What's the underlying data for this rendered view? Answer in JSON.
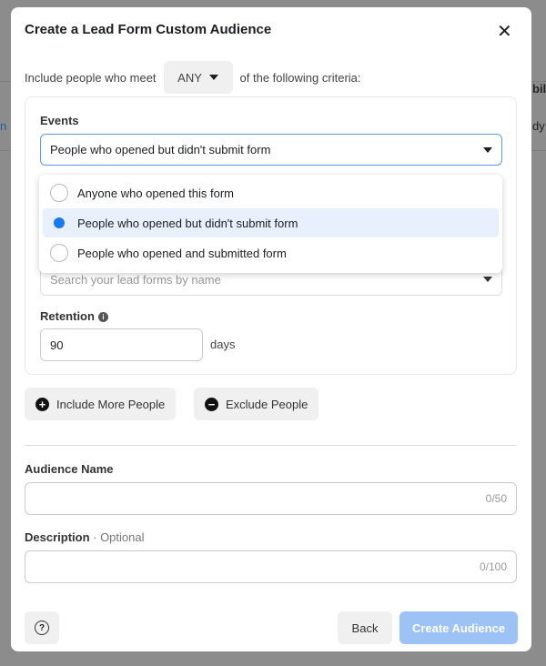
{
  "background": {
    "texts": [
      "n",
      "bil",
      "dy"
    ]
  },
  "modal": {
    "title": "Create a Lead Form Custom Audience",
    "criteria": {
      "prefix": "Include people who meet",
      "selected": "ANY",
      "suffix": "of the following criteria:"
    },
    "events": {
      "label": "Events",
      "selected": "People who opened but didn't submit form",
      "options": [
        {
          "label": "Anyone who opened this form",
          "checked": false
        },
        {
          "label": "People who opened but didn't submit form",
          "checked": true
        },
        {
          "label": "People who opened and submitted form",
          "checked": false
        }
      ],
      "search_placeholder": "Search your lead forms by name"
    },
    "retention": {
      "label": "Retention",
      "value": "90",
      "unit": "days"
    },
    "include_more": "Include More People",
    "exclude": "Exclude People",
    "audience_name": {
      "label": "Audience Name",
      "counter": "0/50",
      "value": ""
    },
    "description": {
      "label": "Description",
      "optional": " · Optional",
      "counter": "0/100",
      "value": ""
    },
    "back": "Back",
    "create": "Create Audience",
    "accent": "#1877f2"
  }
}
